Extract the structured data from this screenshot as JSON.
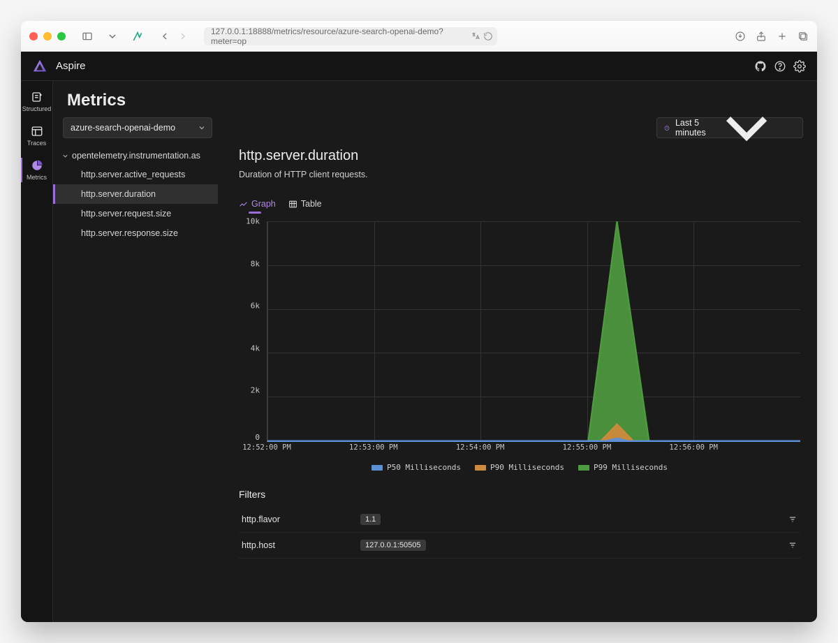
{
  "browser": {
    "url": "127.0.0.1:18888/metrics/resource/azure-search-openai-demo?meter=op"
  },
  "header": {
    "app_name": "Aspire"
  },
  "rail": {
    "items": [
      {
        "label": "Structured"
      },
      {
        "label": "Traces"
      },
      {
        "label": "Metrics"
      }
    ]
  },
  "page": {
    "title": "Metrics",
    "resource_selected": "azure-search-openai-demo",
    "time_selected": "Last 5 minutes"
  },
  "tree": {
    "parent": "opentelemetry.instrumentation.as",
    "items": [
      "http.server.active_requests",
      "http.server.duration",
      "http.server.request.size",
      "http.server.response.size"
    ],
    "active_index": 1
  },
  "metric": {
    "title": "http.server.duration",
    "description": "Duration of HTTP client requests."
  },
  "tabs": {
    "graph": "Graph",
    "table": "Table"
  },
  "chart_data": {
    "type": "area",
    "title": "http.server.duration",
    "xlabel": "",
    "ylabel": "",
    "ylim": [
      0,
      10000
    ],
    "y_ticks": [
      "10k",
      "8k",
      "6k",
      "4k",
      "2k",
      "0"
    ],
    "x_ticks": [
      "12:52:00 PM",
      "12:53:00 PM",
      "12:54:00 PM",
      "12:55:00 PM",
      "12:56:00 PM"
    ],
    "x_range_minutes": [
      52,
      57
    ],
    "series": [
      {
        "name": "P50 Milliseconds",
        "color": "#5c8fd6",
        "points": [
          [
            52,
            0
          ],
          [
            53,
            0
          ],
          [
            54,
            0
          ],
          [
            55,
            0
          ],
          [
            55.18,
            0
          ],
          [
            55.28,
            120
          ],
          [
            55.38,
            0
          ],
          [
            56,
            0
          ],
          [
            57,
            0
          ]
        ]
      },
      {
        "name": "P90 Milliseconds",
        "color": "#d08a3d",
        "points": [
          [
            52,
            0
          ],
          [
            53,
            0
          ],
          [
            54,
            0
          ],
          [
            55,
            0
          ],
          [
            55.13,
            0
          ],
          [
            55.28,
            750
          ],
          [
            55.43,
            0
          ],
          [
            56,
            0
          ],
          [
            57,
            0
          ]
        ]
      },
      {
        "name": "P99 Milliseconds",
        "color": "#4e9a3f",
        "points": [
          [
            52,
            0
          ],
          [
            53,
            0
          ],
          [
            54,
            0
          ],
          [
            55,
            0
          ],
          [
            55.01,
            0
          ],
          [
            55.28,
            10000
          ],
          [
            55.58,
            0
          ],
          [
            56,
            0
          ],
          [
            57,
            0
          ]
        ]
      }
    ]
  },
  "filters": {
    "title": "Filters",
    "rows": [
      {
        "key": "http.flavor",
        "value": "1.1"
      },
      {
        "key": "http.host",
        "value": "127.0.0.1:50505"
      }
    ]
  }
}
